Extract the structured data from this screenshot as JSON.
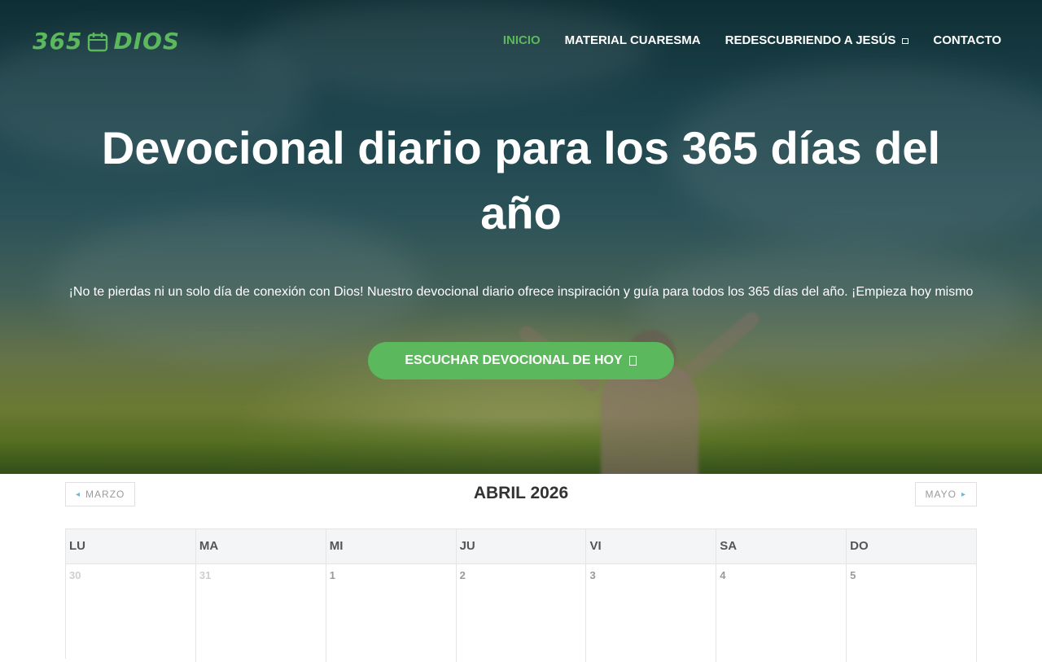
{
  "brand": {
    "logo_text_left": "365",
    "logo_text_right": "DIOS",
    "logo_icon": "calendar-icon",
    "accent_color": "#5cb85c"
  },
  "nav": {
    "items": [
      {
        "label": "INICIO",
        "active": true
      },
      {
        "label": "MATERIAL CUARESMA",
        "active": false
      },
      {
        "label": "REDESCUBRIENDO A JESÚS",
        "active": false,
        "has_dropdown": true,
        "dropdown_icon": "chevron-down-icon"
      },
      {
        "label": "CONTACTO",
        "active": false
      }
    ]
  },
  "hero": {
    "title": "Devocional diario para los 365 días del año",
    "subtitle": "¡No te pierdas ni un solo día de conexión con Dios! Nuestro devocional diario ofrece inspiración y guía para todos los 365 días del año. ¡Empieza hoy mismo",
    "cta_label": "ESCUCHAR DEVOCIONAL DE HOY",
    "cta_icon": "arrow-right-icon"
  },
  "calendar": {
    "title": "ABRIL 2026",
    "prev_label": "MARZO",
    "next_label": "MAYO",
    "weekdays": [
      "LU",
      "MA",
      "MI",
      "JU",
      "VI",
      "SA",
      "DO"
    ],
    "first_week": [
      {
        "day": "30",
        "other_month": true
      },
      {
        "day": "31",
        "other_month": true
      },
      {
        "day": "1",
        "other_month": false
      },
      {
        "day": "2",
        "other_month": false
      },
      {
        "day": "3",
        "other_month": false
      },
      {
        "day": "4",
        "other_month": false
      },
      {
        "day": "5",
        "other_month": false
      }
    ]
  }
}
